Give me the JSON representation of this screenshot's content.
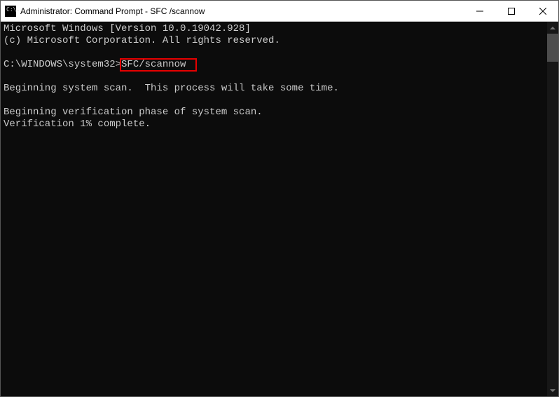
{
  "window": {
    "title": "Administrator: Command Prompt - SFC /scannow",
    "icon_glyph": "C:\\."
  },
  "console": {
    "line1": "Microsoft Windows [Version 10.0.19042.928]",
    "line2": "(c) Microsoft Corporation. All rights reserved.",
    "blank1": "",
    "prompt_prefix": "C:\\WINDOWS\\system32>",
    "prompt_command": "SFC/scannow",
    "blank2": "",
    "line3": "Beginning system scan.  This process will take some time.",
    "blank3": "",
    "line4": "Beginning verification phase of system scan.",
    "line5": "Verification 1% complete."
  },
  "highlight": {
    "target": "SFC/scannow"
  }
}
